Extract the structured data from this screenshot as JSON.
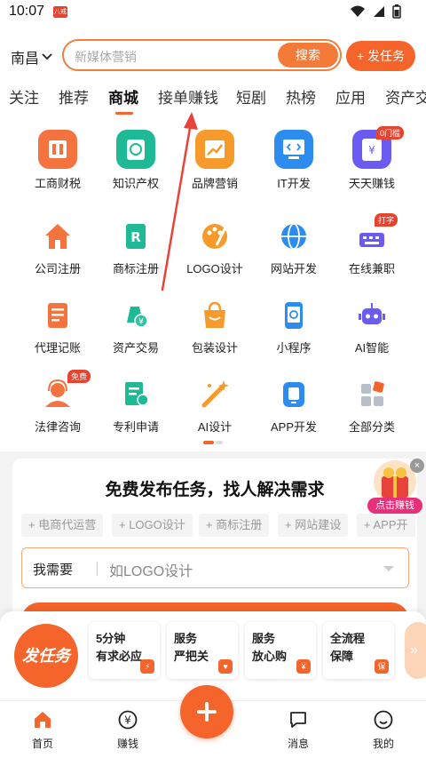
{
  "status_bar": {
    "time": "10:07",
    "app_badge": "八戒"
  },
  "header": {
    "city": "南昌",
    "search_placeholder": "新媒体营销",
    "search_button": "搜索",
    "publish_button": "+ 发任务"
  },
  "tabs": [
    {
      "label": "关注"
    },
    {
      "label": "推荐"
    },
    {
      "label": "商城",
      "active": true
    },
    {
      "label": "接单赚钱"
    },
    {
      "label": "短剧"
    },
    {
      "label": "热榜"
    },
    {
      "label": "应用"
    },
    {
      "label": "资产交"
    }
  ],
  "grid": {
    "row1": [
      {
        "label": "工商财税",
        "icon": "building-icon"
      },
      {
        "label": "知识产权",
        "icon": "copyright-icon"
      },
      {
        "label": "品牌营销",
        "icon": "chart-icon"
      },
      {
        "label": "IT开发",
        "icon": "code-monitor-icon"
      },
      {
        "label": "天天赚钱",
        "icon": "wallet-icon",
        "badge": "0门槛"
      }
    ],
    "row2": [
      {
        "label": "公司注册",
        "icon": "home-icon"
      },
      {
        "label": "商标注册",
        "icon": "trademark-icon"
      },
      {
        "label": "LOGO设计",
        "icon": "palette-icon"
      },
      {
        "label": "网站开发",
        "icon": "globe-icon"
      },
      {
        "label": "在线兼职",
        "icon": "typing-icon",
        "badge": "打字"
      }
    ],
    "row3": [
      {
        "label": "代理记账",
        "icon": "ledger-icon"
      },
      {
        "label": "资产交易",
        "icon": "asset-icon"
      },
      {
        "label": "包装设计",
        "icon": "bag-icon"
      },
      {
        "label": "小程序",
        "icon": "phone-app-icon"
      },
      {
        "label": "AI智能",
        "icon": "robot-icon"
      }
    ],
    "row4": [
      {
        "label": "法律咨询",
        "icon": "lawyer-icon",
        "badge": "免费"
      },
      {
        "label": "专利申请",
        "icon": "patent-icon"
      },
      {
        "label": "AI设计",
        "icon": "magic-wand-icon"
      },
      {
        "label": "APP开发",
        "icon": "mobile-icon"
      },
      {
        "label": "全部分类",
        "icon": "all-categories-icon"
      }
    ]
  },
  "task_card": {
    "title": "免费发布任务，找人解决需求",
    "chips": [
      "+ 电商代运营",
      "+ LOGO设计",
      "+ 商标注册",
      "+ 网站建设",
      "+ APP开"
    ],
    "need_label": "我需要",
    "need_placeholder": "如LOGO设计",
    "promo_label": "点击赚钱"
  },
  "bottom_sheet": {
    "logo_text": "发任务",
    "features": [
      {
        "line1": "5分钟",
        "line2": "有求必应",
        "icon": "⚡"
      },
      {
        "line1": "服务",
        "line2": "严把关",
        "icon": "♥"
      },
      {
        "line1": "服务",
        "line2": "放心购",
        "icon": "¥"
      },
      {
        "line1": "全流程",
        "line2": "保障",
        "icon": "保"
      }
    ],
    "more": "»"
  },
  "nav": {
    "home": "首页",
    "earn": "赚钱",
    "messages": "消息",
    "mine": "我的"
  },
  "colors": {
    "accent": "#f4642b",
    "accent_light": "#f47a3a",
    "badge_red": "#e8432e",
    "annotation_arrow": "#e8433a"
  }
}
